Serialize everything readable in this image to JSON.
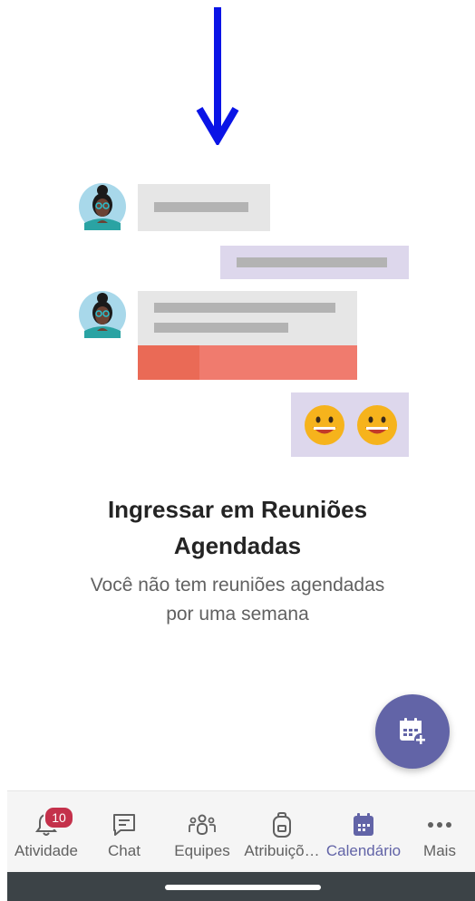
{
  "empty_state": {
    "title_line1": "Ingressar em Reuniões",
    "title_line2": "Agendadas",
    "subtitle_line1": "Você não tem reuniões agendadas",
    "subtitle_line2": "por uma semana"
  },
  "fab": {
    "icon": "calendar-add-icon",
    "color": "#6264a7"
  },
  "nav": {
    "items": [
      {
        "label": "Atividade",
        "icon": "bell-icon",
        "badge": "10"
      },
      {
        "label": "Chat",
        "icon": "chat-icon"
      },
      {
        "label": "Equipes",
        "icon": "teams-icon"
      },
      {
        "label": "Atribuiçõ…",
        "icon": "backpack-icon"
      },
      {
        "label": "Calendário",
        "icon": "calendar-icon",
        "active": true
      },
      {
        "label": "Mais",
        "icon": "more-icon"
      }
    ],
    "accent": "#6264a7",
    "badge_color": "#c4314b"
  },
  "colors": {
    "arrow": "#0a14e6",
    "bubble_gray": "#e6e6e6",
    "bubble_lavender": "#ddd7ec",
    "bubble_coral": "#f07b6e"
  }
}
